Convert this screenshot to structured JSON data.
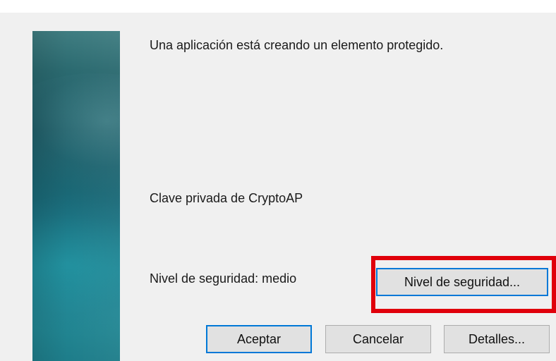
{
  "dialog": {
    "message": "Una aplicación está creando un elemento protegido.",
    "key_name": "Clave privada de CryptoAP",
    "security_level_text": "Nivel de seguridad: medio"
  },
  "buttons": {
    "security_level": "Nivel de seguridad...",
    "accept": "Aceptar",
    "cancel": "Cancelar",
    "details": "Detalles..."
  },
  "colors": {
    "highlight": "#e0000b",
    "focus_border": "#0078d7",
    "dialog_background": "#f0f0f0",
    "banner_teal": "#1d8592"
  }
}
